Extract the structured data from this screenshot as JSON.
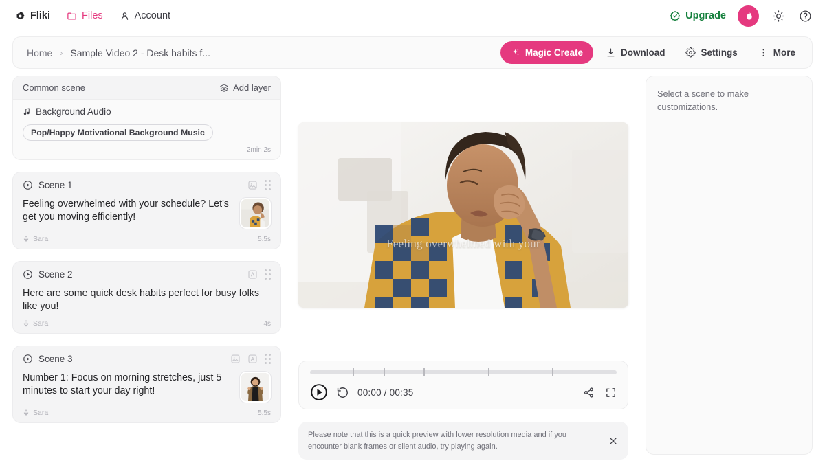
{
  "topnav": {
    "brand": {
      "label": "Fliki",
      "icon": "fliki-gear-icon"
    },
    "items": [
      {
        "label": "Files",
        "icon": "folder-icon",
        "active": true
      },
      {
        "label": "Account",
        "icon": "user-icon",
        "active": false
      }
    ],
    "upgrade": {
      "label": "Upgrade",
      "icon": "badge-check-icon",
      "color": "#15803d"
    },
    "avatar": {
      "icon": "flame-icon",
      "color": "#e5397f"
    },
    "theme_toggle_icon": "sun-icon",
    "help_icon": "help-circle-icon"
  },
  "breadcrumb": {
    "home": "Home",
    "separator": "›",
    "current": "Sample Video 2 - Desk habits f...",
    "actions": {
      "magic_create": "Magic Create",
      "download": "Download",
      "settings": "Settings",
      "more": "More"
    }
  },
  "common_scene": {
    "title": "Common scene",
    "add_layer": "Add layer",
    "background_audio_label": "Background Audio",
    "track": "Pop/Happy Motivational Background Music",
    "duration": "2min 2s"
  },
  "scenes": [
    {
      "name": "Scene 1",
      "text": "Feeling overwhelmed with your schedule? Let's get you moving efficiently!",
      "voice": "Sara",
      "duration": "5.5s",
      "has_image_icon": true,
      "has_text_icon": false,
      "has_thumbnail": true
    },
    {
      "name": "Scene 2",
      "text": "Here are some quick desk habits perfect for busy folks like you!",
      "voice": "Sara",
      "duration": "4s",
      "has_image_icon": false,
      "has_text_icon": true,
      "has_thumbnail": false
    },
    {
      "name": "Scene 3",
      "text": "Number 1: Focus on morning stretches, just 5 minutes to start your day right!",
      "voice": "Sara",
      "duration": "5.5s",
      "has_image_icon": true,
      "has_text_icon": true,
      "has_thumbnail": true
    }
  ],
  "preview": {
    "caption": "Feeling overwhelmed with your",
    "progress_percent": 0,
    "current_time": "00:00",
    "total_time": "00:35",
    "time_display": "00:00 / 00:35",
    "tick_positions": [
      14,
      23,
      32,
      49,
      71
    ]
  },
  "notice": {
    "text": "Please note that this is a quick preview with lower resolution media and if you encounter blank frames or silent audio, try playing again.",
    "close_icon": "close-icon"
  },
  "right_panel": {
    "message": "Select a scene to make customizations."
  }
}
